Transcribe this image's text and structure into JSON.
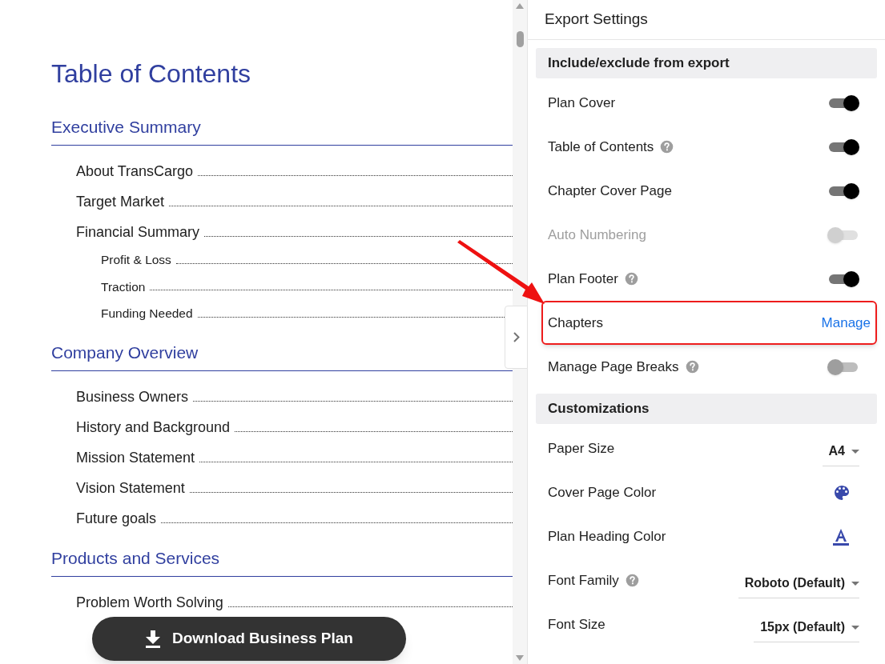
{
  "document": {
    "title": "Table of Contents",
    "sections": [
      {
        "heading": "Executive Summary",
        "items": [
          {
            "label": "About TransCargo"
          },
          {
            "label": "Target Market"
          },
          {
            "label": "Financial Summary",
            "children": [
              {
                "label": "Profit & Loss"
              },
              {
                "label": "Traction"
              },
              {
                "label": "Funding Needed"
              }
            ]
          }
        ]
      },
      {
        "heading": "Company Overview",
        "items": [
          {
            "label": "Business Owners"
          },
          {
            "label": "History and Background"
          },
          {
            "label": "Mission Statement"
          },
          {
            "label": "Vision Statement"
          },
          {
            "label": "Future goals"
          }
        ]
      },
      {
        "heading": "Products and Services",
        "items": [
          {
            "label": "Problem Worth Solving"
          }
        ]
      }
    ]
  },
  "download_button": {
    "label": "Download Business Plan"
  },
  "panel": {
    "title": "Export Settings",
    "groups": [
      {
        "heading": "Include/exclude from export",
        "rows": [
          {
            "kind": "toggle",
            "label": "Plan Cover",
            "help": false,
            "on": true,
            "disabled": false
          },
          {
            "kind": "toggle",
            "label": "Table of Contents",
            "help": true,
            "on": true,
            "disabled": false
          },
          {
            "kind": "toggle",
            "label": "Chapter Cover Page",
            "help": false,
            "on": true,
            "disabled": false
          },
          {
            "kind": "toggle",
            "label": "Auto Numbering",
            "help": false,
            "on": false,
            "disabled": true
          },
          {
            "kind": "toggle",
            "label": "Plan Footer",
            "help": true,
            "on": true,
            "disabled": false
          },
          {
            "kind": "link",
            "label": "Chapters",
            "help": false,
            "link": "Manage",
            "highlighted": true
          },
          {
            "kind": "toggle",
            "label": "Manage Page Breaks",
            "help": true,
            "on": false,
            "disabled": false
          }
        ]
      },
      {
        "heading": "Customizations",
        "rows": [
          {
            "kind": "select",
            "label": "Paper Size",
            "help": false,
            "value": "A4"
          },
          {
            "kind": "palette",
            "label": "Cover Page Color",
            "help": false
          },
          {
            "kind": "text-color",
            "label": "Plan Heading Color",
            "help": false
          },
          {
            "kind": "select",
            "label": "Font Family",
            "help": true,
            "value": "Roboto (Default)"
          },
          {
            "kind": "select",
            "label": "Font Size",
            "help": false,
            "value": "15px (Default)"
          }
        ]
      }
    ]
  }
}
